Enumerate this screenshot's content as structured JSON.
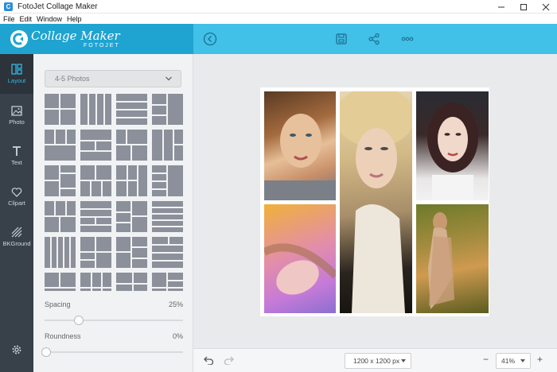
{
  "window": {
    "title": "FotoJet Collage Maker",
    "controls": [
      "minimize",
      "maximize",
      "close"
    ]
  },
  "menu": [
    "File",
    "Edit",
    "Window",
    "Help"
  ],
  "brand": {
    "name": "Collage Maker",
    "sub": "FOTOJET",
    "color": "#1fa4d1"
  },
  "toolbar": {
    "back_icon": "chevron-left-icon",
    "save_icon": "save-icon",
    "share_icon": "share-icon",
    "more_icon": "more-icon"
  },
  "nav": [
    {
      "label": "Layout",
      "icon": "layout-icon",
      "active": true
    },
    {
      "label": "Photo",
      "icon": "photo-icon",
      "active": false
    },
    {
      "label": "Text",
      "icon": "text-icon",
      "active": false
    },
    {
      "label": "Clipart",
      "icon": "heart-icon",
      "active": false
    },
    {
      "label": "BKGround",
      "icon": "background-icon",
      "active": false
    }
  ],
  "layout_panel": {
    "category": "4-5 Photos",
    "template_count": 24,
    "spacing_label": "Spacing",
    "spacing_value": "25%",
    "roundness_label": "Roundness",
    "roundness_value": "0%"
  },
  "canvas": {
    "photos": [
      "photo-1",
      "photo-2",
      "photo-3",
      "photo-4",
      "photo-5"
    ]
  },
  "bottom": {
    "size": "1200 x 1200 px",
    "zoom": "41%",
    "zoom_out": "−",
    "zoom_in": "+"
  },
  "colors": {
    "accent": "#41c0e8",
    "nav_bg": "#38404a",
    "active_nav": "#35b6e4"
  }
}
